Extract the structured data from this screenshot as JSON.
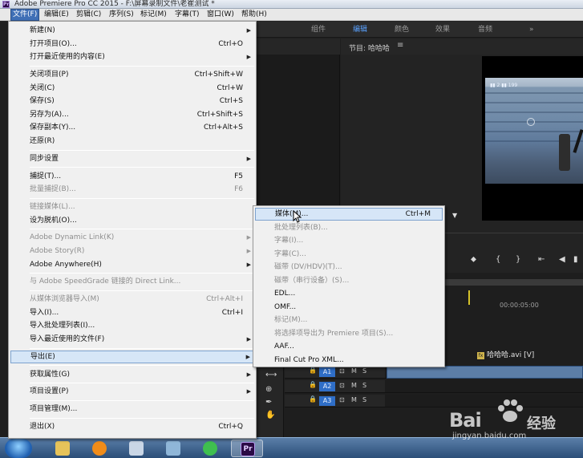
{
  "window": {
    "title": "Adobe Premiere Pro CC 2015 - F:\\屏幕录制文件\\老崔测试 *",
    "logo_text": "Pr"
  },
  "menubar": [
    {
      "label": "文件(F)",
      "active": true
    },
    {
      "label": "编辑(E)"
    },
    {
      "label": "剪辑(C)"
    },
    {
      "label": "序列(S)"
    },
    {
      "label": "标记(M)"
    },
    {
      "label": "字幕(T)"
    },
    {
      "label": "窗口(W)"
    },
    {
      "label": "帮助(H)"
    }
  ],
  "workspace_tabs": [
    "组件",
    "编辑",
    "颜色",
    "效果",
    "音频",
    "»"
  ],
  "active_workspace": "编辑",
  "program_monitor": {
    "title": "节目: 哈哈哈",
    "menu_glyph": "≡",
    "hud_text": "▮▮ 2 ▮▮ 199"
  },
  "timecode": "00:00:05:00",
  "timeline": {
    "clip_label": "哈哈哈.avi [V]",
    "fx_badge": "fx",
    "tracks": [
      {
        "id": "A1",
        "m": "M",
        "s": "S"
      },
      {
        "id": "A2",
        "m": "M",
        "s": "S"
      },
      {
        "id": "A3",
        "m": "M",
        "s": "S"
      }
    ],
    "lock_glyph": "🔒",
    "clip_icon": "⊡"
  },
  "file_menu": {
    "items": [
      {
        "label": "新建(N)",
        "shortcut": "",
        "submenu": true
      },
      {
        "label": "打开项目(O)...",
        "shortcut": "Ctrl+O"
      },
      {
        "label": "打开最近使用的内容(E)",
        "shortcut": "",
        "submenu": true
      },
      {
        "sep": true
      },
      {
        "label": "关闭项目(P)",
        "shortcut": "Ctrl+Shift+W"
      },
      {
        "label": "关闭(C)",
        "shortcut": "Ctrl+W"
      },
      {
        "label": "保存(S)",
        "shortcut": "Ctrl+S"
      },
      {
        "label": "另存为(A)...",
        "shortcut": "Ctrl+Shift+S"
      },
      {
        "label": "保存副本(Y)...",
        "shortcut": "Ctrl+Alt+S"
      },
      {
        "label": "还原(R)",
        "shortcut": ""
      },
      {
        "sep": true
      },
      {
        "label": "同步设置",
        "shortcut": "",
        "submenu": true
      },
      {
        "sep": true
      },
      {
        "label": "捕捉(T)...",
        "shortcut": "F5"
      },
      {
        "label": "批量捕捉(B)...",
        "shortcut": "F6",
        "disabled": true
      },
      {
        "sep": true
      },
      {
        "label": "链接媒体(L)...",
        "shortcut": "",
        "disabled": true
      },
      {
        "label": "设为脱机(O)...",
        "shortcut": ""
      },
      {
        "sep": true
      },
      {
        "label": "Adobe Dynamic Link(K)",
        "shortcut": "",
        "submenu": true,
        "disabled": true
      },
      {
        "label": "Adobe Story(R)",
        "shortcut": "",
        "submenu": true,
        "disabled": true
      },
      {
        "label": "Adobe Anywhere(H)",
        "shortcut": "",
        "submenu": true
      },
      {
        "sep": true
      },
      {
        "label": "与 Adobe SpeedGrade 链接的 Direct Link...",
        "shortcut": "",
        "disabled": true
      },
      {
        "sep": true
      },
      {
        "label": "从媒体浏览器导入(M)",
        "shortcut": "Ctrl+Alt+I",
        "disabled": true
      },
      {
        "label": "导入(I)...",
        "shortcut": "Ctrl+I"
      },
      {
        "label": "导入批处理列表(I)...",
        "shortcut": ""
      },
      {
        "label": "导入最近使用的文件(F)",
        "shortcut": "",
        "submenu": true
      },
      {
        "sep": true
      },
      {
        "label": "导出(E)",
        "shortcut": "",
        "submenu": true,
        "highlighted": true
      },
      {
        "sep": true
      },
      {
        "label": "获取属性(G)",
        "shortcut": "",
        "submenu": true
      },
      {
        "sep": true
      },
      {
        "label": "项目设置(P)",
        "shortcut": "",
        "submenu": true
      },
      {
        "sep": true
      },
      {
        "label": "项目管理(M)...",
        "shortcut": ""
      },
      {
        "sep": true
      },
      {
        "label": "退出(X)",
        "shortcut": "Ctrl+Q"
      }
    ]
  },
  "export_submenu": {
    "items": [
      {
        "label": "媒体(M)...",
        "shortcut": "Ctrl+M",
        "highlighted": true
      },
      {
        "label": "批处理列表(B)...",
        "disabled": true
      },
      {
        "label": "字幕(I)...",
        "disabled": true
      },
      {
        "label": "字幕(C)...",
        "disabled": true
      },
      {
        "label": "磁带 (DV/HDV)(T)...",
        "disabled": true
      },
      {
        "label": "磁带（串行设备）(S)...",
        "disabled": true
      },
      {
        "label": "EDL..."
      },
      {
        "label": "OMF..."
      },
      {
        "label": "标记(M)...",
        "disabled": true
      },
      {
        "label": "将选择项导出为 Premiere 项目(S)...",
        "disabled": true
      },
      {
        "label": "AAF..."
      },
      {
        "label": "Final Cut Pro XML..."
      }
    ]
  },
  "watermark": {
    "brand": "Bai",
    "brand2": "经验",
    "url": "jingyan.baidu.com"
  },
  "taskbar": {
    "active_app": "Pr"
  }
}
